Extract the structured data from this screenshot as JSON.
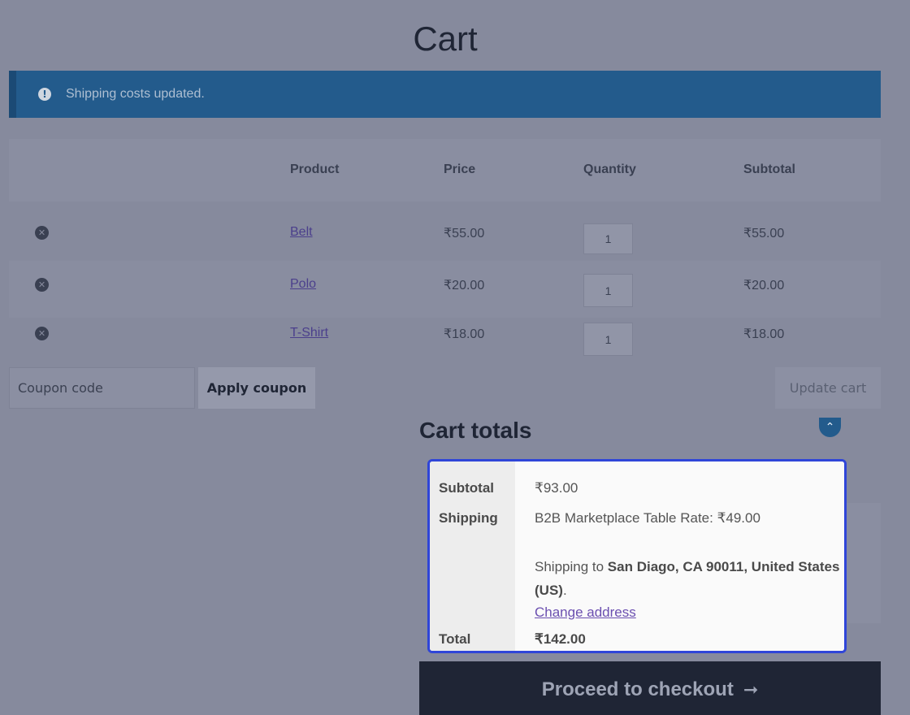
{
  "page": {
    "title": "Cart"
  },
  "notice": {
    "icon": "info-icon",
    "icon_glyph": "!",
    "text": "Shipping costs updated."
  },
  "table": {
    "headers": {
      "product": "Product",
      "price": "Price",
      "quantity": "Quantity",
      "subtotal": "Subtotal"
    },
    "rows": [
      {
        "product": "Belt",
        "price": "₹55.00",
        "quantity": "1",
        "subtotal": "₹55.00"
      },
      {
        "product": "Polo",
        "price": "₹20.00",
        "quantity": "1",
        "subtotal": "₹20.00"
      },
      {
        "product": "T-Shirt",
        "price": "₹18.00",
        "quantity": "1",
        "subtotal": "₹18.00"
      }
    ],
    "remove_glyph": "✕"
  },
  "actions": {
    "coupon_placeholder": "Coupon code",
    "apply_label": "Apply coupon",
    "update_label": "Update cart"
  },
  "totals": {
    "heading": "Cart totals",
    "subtotal_label": "Subtotal",
    "subtotal_value": "₹93.00",
    "shipping_label": "Shipping",
    "shipping_method": "B2B Marketplace Table Rate: ₹49.00",
    "shipping_to_prefix": "Shipping to ",
    "shipping_destination_line1": "San Diago, CA 90011, United States",
    "shipping_destination_line2": "(US)",
    "shipping_to_suffix": ".",
    "change_address": "Change address",
    "total_label": "Total",
    "total_value": "₹142.00"
  },
  "checkout": {
    "label": "Proceed to checkout",
    "arrow": "➞"
  },
  "scroll_top": {
    "icon": "chevron-up-icon",
    "glyph": "⌃"
  },
  "colors": {
    "accent": "#235b8c",
    "highlight_border": "#2f45d8",
    "checkout_bg": "#1f2535",
    "link": "#4b3f8c"
  }
}
